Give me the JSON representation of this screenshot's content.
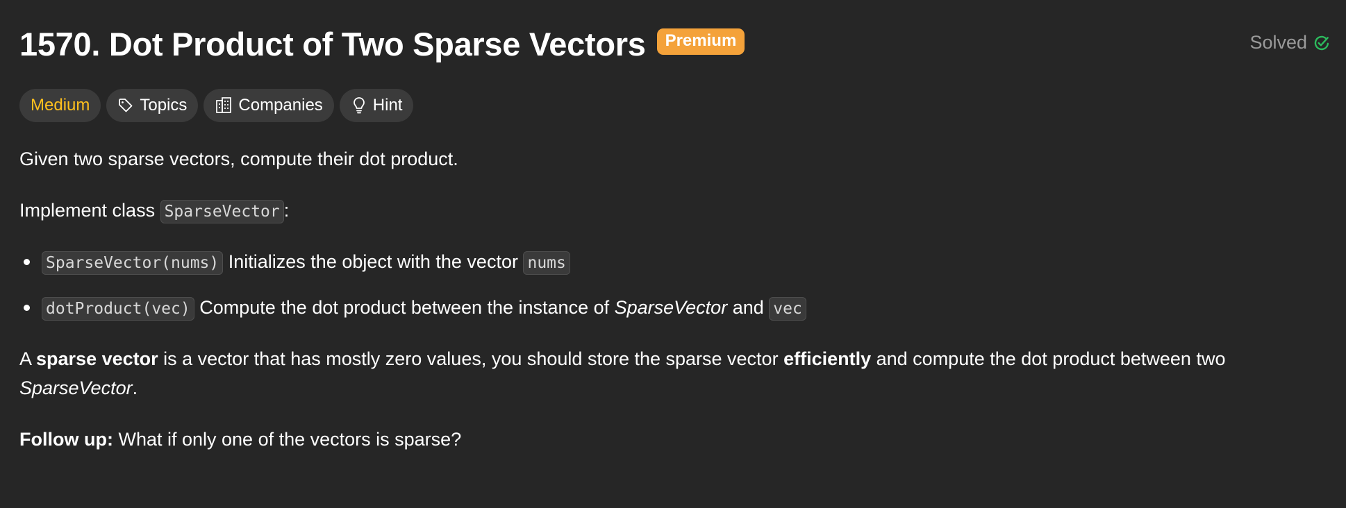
{
  "problem": {
    "number_title": "1570. Dot Product of Two Sparse Vectors",
    "premium_label": "Premium",
    "status_label": "Solved"
  },
  "tags": {
    "difficulty": "Medium",
    "topics": "Topics",
    "companies": "Companies",
    "hint": "Hint"
  },
  "description": {
    "intro": "Given two sparse vectors, compute their dot product.",
    "implement_prefix": "Implement class ",
    "implement_class": "SparseVector",
    "implement_suffix": ":",
    "bullets": [
      {
        "code": "SparseVector(nums)",
        "text": " Initializes the object with the vector ",
        "code2": "nums"
      },
      {
        "code": "dotProduct(vec)",
        "text": " Compute the dot product between the instance of ",
        "italic": "SparseVector",
        "text2": " and ",
        "code2": "vec"
      }
    ],
    "para": {
      "t1": "A ",
      "b1": "sparse vector",
      "t2": " is a vector that has mostly zero values, you should store the sparse vector ",
      "b2": "efficiently",
      "t3": " and compute the dot product between two",
      "i1": "SparseVector",
      "t4": "."
    },
    "follow_up": {
      "label": "Follow up:",
      "text": " What if only one of the vectors is sparse?"
    }
  },
  "colors": {
    "background": "#262626",
    "premium": "#f4a23a",
    "medium": "#ffc01e",
    "solved_check": "#2cbb5d",
    "tag_bg": "#3b3b3b"
  },
  "icons": {
    "topics": "tag-icon",
    "companies": "building-icon",
    "hint": "lightbulb-icon",
    "solved": "check-circle-icon"
  }
}
